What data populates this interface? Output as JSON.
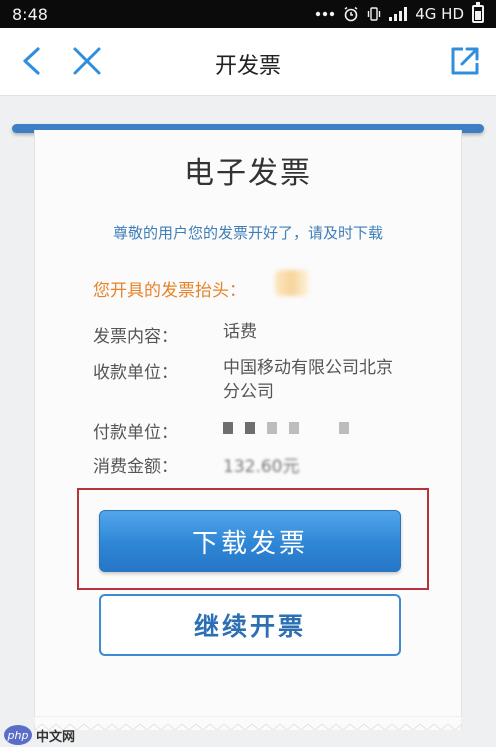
{
  "status_bar": {
    "time": "8:48",
    "network": "4G HD"
  },
  "nav": {
    "title": "开发票",
    "icons": [
      "back-chevron-icon",
      "close-icon",
      "share-icon"
    ]
  },
  "receipt": {
    "title": "电子发票",
    "subtitle": "尊敬的用户您的发票开好了，请及时下载",
    "header_label": "您开具的发票抬头：",
    "rows": [
      {
        "label": "发票内容：",
        "value": "话费"
      },
      {
        "label": "收款单位：",
        "value_line1": "中国移动有限公司北京",
        "value_line2": "分公司"
      },
      {
        "label": "付款单位："
      },
      {
        "label": "消费金额：",
        "value": "132.60元"
      }
    ]
  },
  "buttons": {
    "download": "下载发票",
    "continue": "继续开票"
  },
  "watermark": {
    "badge": "php",
    "text": "中文网"
  },
  "colors": {
    "accent_blue": "#2e86d6",
    "highlight_red": "#b8323a",
    "orange_text": "#e5842b"
  }
}
